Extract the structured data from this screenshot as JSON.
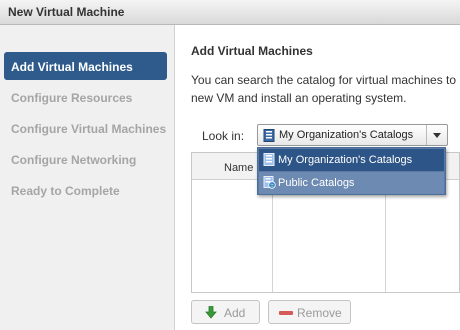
{
  "window": {
    "title": "New Virtual Machine"
  },
  "sidebar": {
    "items": [
      {
        "label": "Add Virtual Machines",
        "active": true
      },
      {
        "label": "Configure Resources",
        "active": false
      },
      {
        "label": "Configure Virtual Machines",
        "active": false
      },
      {
        "label": "Configure Networking",
        "active": false
      },
      {
        "label": "Ready to Complete",
        "active": false
      }
    ]
  },
  "main": {
    "title": "Add Virtual Machines",
    "description_line1": "You can search the catalog for virtual machines to",
    "description_line2": "new VM and install an operating system.",
    "look_in": {
      "label": "Look in:",
      "value": "My Organization's Catalogs",
      "options": [
        "My Organization's Catalogs",
        "Public Catalogs"
      ]
    },
    "table": {
      "columns": [
        "Name"
      ]
    },
    "buttons": {
      "add": "Add",
      "remove": "Remove"
    }
  },
  "icons": {
    "catalog": "catalog-icon",
    "public_catalog": "public-catalog-icon",
    "add": "green-down-arrow-icon",
    "remove": "remove-bar-icon",
    "dropdown": "chevron-down-icon"
  },
  "colors": {
    "nav_active_bg": "#2e5b8c",
    "dropdown_selected_bg": "#2d5587",
    "dropdown_bg": "#5a7aa5",
    "remove_red": "#d75a5a",
    "add_green": "#3a9a3a"
  }
}
